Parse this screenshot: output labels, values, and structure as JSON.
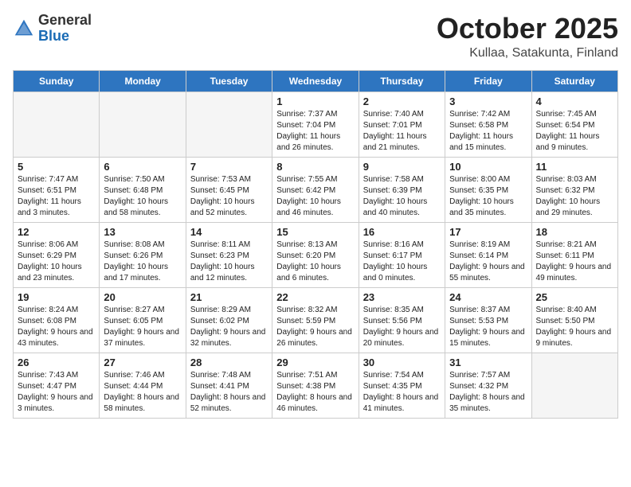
{
  "header": {
    "logo_general": "General",
    "logo_blue": "Blue",
    "month": "October 2025",
    "location": "Kullaa, Satakunta, Finland"
  },
  "weekdays": [
    "Sunday",
    "Monday",
    "Tuesday",
    "Wednesday",
    "Thursday",
    "Friday",
    "Saturday"
  ],
  "weeks": [
    [
      {
        "day": "",
        "info": ""
      },
      {
        "day": "",
        "info": ""
      },
      {
        "day": "",
        "info": ""
      },
      {
        "day": "1",
        "info": "Sunrise: 7:37 AM\nSunset: 7:04 PM\nDaylight: 11 hours\nand 26 minutes."
      },
      {
        "day": "2",
        "info": "Sunrise: 7:40 AM\nSunset: 7:01 PM\nDaylight: 11 hours\nand 21 minutes."
      },
      {
        "day": "3",
        "info": "Sunrise: 7:42 AM\nSunset: 6:58 PM\nDaylight: 11 hours\nand 15 minutes."
      },
      {
        "day": "4",
        "info": "Sunrise: 7:45 AM\nSunset: 6:54 PM\nDaylight: 11 hours\nand 9 minutes."
      }
    ],
    [
      {
        "day": "5",
        "info": "Sunrise: 7:47 AM\nSunset: 6:51 PM\nDaylight: 11 hours\nand 3 minutes."
      },
      {
        "day": "6",
        "info": "Sunrise: 7:50 AM\nSunset: 6:48 PM\nDaylight: 10 hours\nand 58 minutes."
      },
      {
        "day": "7",
        "info": "Sunrise: 7:53 AM\nSunset: 6:45 PM\nDaylight: 10 hours\nand 52 minutes."
      },
      {
        "day": "8",
        "info": "Sunrise: 7:55 AM\nSunset: 6:42 PM\nDaylight: 10 hours\nand 46 minutes."
      },
      {
        "day": "9",
        "info": "Sunrise: 7:58 AM\nSunset: 6:39 PM\nDaylight: 10 hours\nand 40 minutes."
      },
      {
        "day": "10",
        "info": "Sunrise: 8:00 AM\nSunset: 6:35 PM\nDaylight: 10 hours\nand 35 minutes."
      },
      {
        "day": "11",
        "info": "Sunrise: 8:03 AM\nSunset: 6:32 PM\nDaylight: 10 hours\nand 29 minutes."
      }
    ],
    [
      {
        "day": "12",
        "info": "Sunrise: 8:06 AM\nSunset: 6:29 PM\nDaylight: 10 hours\nand 23 minutes."
      },
      {
        "day": "13",
        "info": "Sunrise: 8:08 AM\nSunset: 6:26 PM\nDaylight: 10 hours\nand 17 minutes."
      },
      {
        "day": "14",
        "info": "Sunrise: 8:11 AM\nSunset: 6:23 PM\nDaylight: 10 hours\nand 12 minutes."
      },
      {
        "day": "15",
        "info": "Sunrise: 8:13 AM\nSunset: 6:20 PM\nDaylight: 10 hours\nand 6 minutes."
      },
      {
        "day": "16",
        "info": "Sunrise: 8:16 AM\nSunset: 6:17 PM\nDaylight: 10 hours\nand 0 minutes."
      },
      {
        "day": "17",
        "info": "Sunrise: 8:19 AM\nSunset: 6:14 PM\nDaylight: 9 hours\nand 55 minutes."
      },
      {
        "day": "18",
        "info": "Sunrise: 8:21 AM\nSunset: 6:11 PM\nDaylight: 9 hours\nand 49 minutes."
      }
    ],
    [
      {
        "day": "19",
        "info": "Sunrise: 8:24 AM\nSunset: 6:08 PM\nDaylight: 9 hours\nand 43 minutes."
      },
      {
        "day": "20",
        "info": "Sunrise: 8:27 AM\nSunset: 6:05 PM\nDaylight: 9 hours\nand 37 minutes."
      },
      {
        "day": "21",
        "info": "Sunrise: 8:29 AM\nSunset: 6:02 PM\nDaylight: 9 hours\nand 32 minutes."
      },
      {
        "day": "22",
        "info": "Sunrise: 8:32 AM\nSunset: 5:59 PM\nDaylight: 9 hours\nand 26 minutes."
      },
      {
        "day": "23",
        "info": "Sunrise: 8:35 AM\nSunset: 5:56 PM\nDaylight: 9 hours\nand 20 minutes."
      },
      {
        "day": "24",
        "info": "Sunrise: 8:37 AM\nSunset: 5:53 PM\nDaylight: 9 hours\nand 15 minutes."
      },
      {
        "day": "25",
        "info": "Sunrise: 8:40 AM\nSunset: 5:50 PM\nDaylight: 9 hours\nand 9 minutes."
      }
    ],
    [
      {
        "day": "26",
        "info": "Sunrise: 7:43 AM\nSunset: 4:47 PM\nDaylight: 9 hours\nand 3 minutes."
      },
      {
        "day": "27",
        "info": "Sunrise: 7:46 AM\nSunset: 4:44 PM\nDaylight: 8 hours\nand 58 minutes."
      },
      {
        "day": "28",
        "info": "Sunrise: 7:48 AM\nSunset: 4:41 PM\nDaylight: 8 hours\nand 52 minutes."
      },
      {
        "day": "29",
        "info": "Sunrise: 7:51 AM\nSunset: 4:38 PM\nDaylight: 8 hours\nand 46 minutes."
      },
      {
        "day": "30",
        "info": "Sunrise: 7:54 AM\nSunset: 4:35 PM\nDaylight: 8 hours\nand 41 minutes."
      },
      {
        "day": "31",
        "info": "Sunrise: 7:57 AM\nSunset: 4:32 PM\nDaylight: 8 hours\nand 35 minutes."
      },
      {
        "day": "",
        "info": ""
      }
    ]
  ]
}
